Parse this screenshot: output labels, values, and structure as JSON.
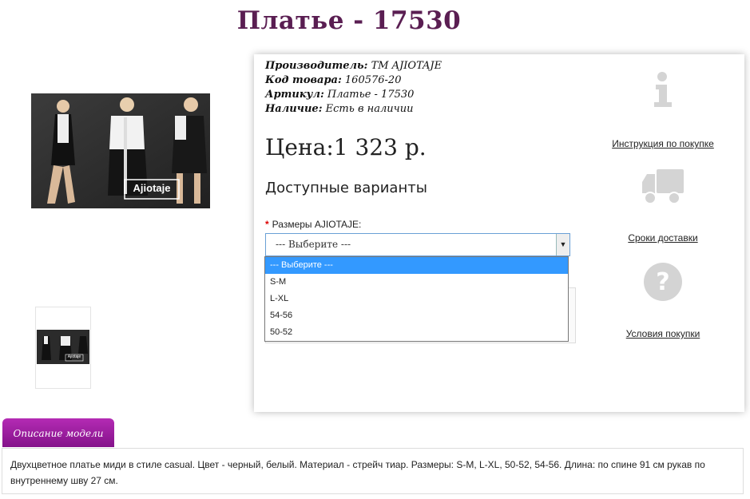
{
  "product": {
    "title": "Платье - 17530",
    "photo_brand_text": "Ajiotaje",
    "thumb_brand_text": "Ajiotaje"
  },
  "info": {
    "manufacturer_label": "Производитель:",
    "manufacturer_value": "ТМ AJIOTAJE",
    "code_label": "Код товара:",
    "code_value": "160576-20",
    "article_label": "Артикул:",
    "article_value": "Платье - 17530",
    "availability_label": "Наличие:",
    "availability_value": "Есть в наличии",
    "price": "Цена:1 323 р.",
    "variants_heading": "Доступные варианты",
    "size_required_mark": "*",
    "size_label": "Размеры AJIOTAJE:",
    "size_selected": "--- Выберите ---"
  },
  "size_options": [
    "--- Выберите ---",
    "S-M",
    "L-XL",
    "54-56",
    "50-52"
  ],
  "side_links": {
    "instructions": "Инструкция по покупке",
    "delivery": "Сроки доставки",
    "conditions": "Условия покупки"
  },
  "description": {
    "tab_label": "Описание модели",
    "text": "Двухцветное платье миди в стиле casual. Цвет - черный, белый. Материал - стрейч тиар. Размеры: S-M, L-XL, 50-52, 54-56. Длина: по спине 91 см рукав по внутреннему шву 27 см."
  },
  "colors": {
    "title": "#5a1e52",
    "tab": "#a020a8",
    "select_highlight": "#3399ff",
    "icon_gray": "#d4d4d4"
  }
}
